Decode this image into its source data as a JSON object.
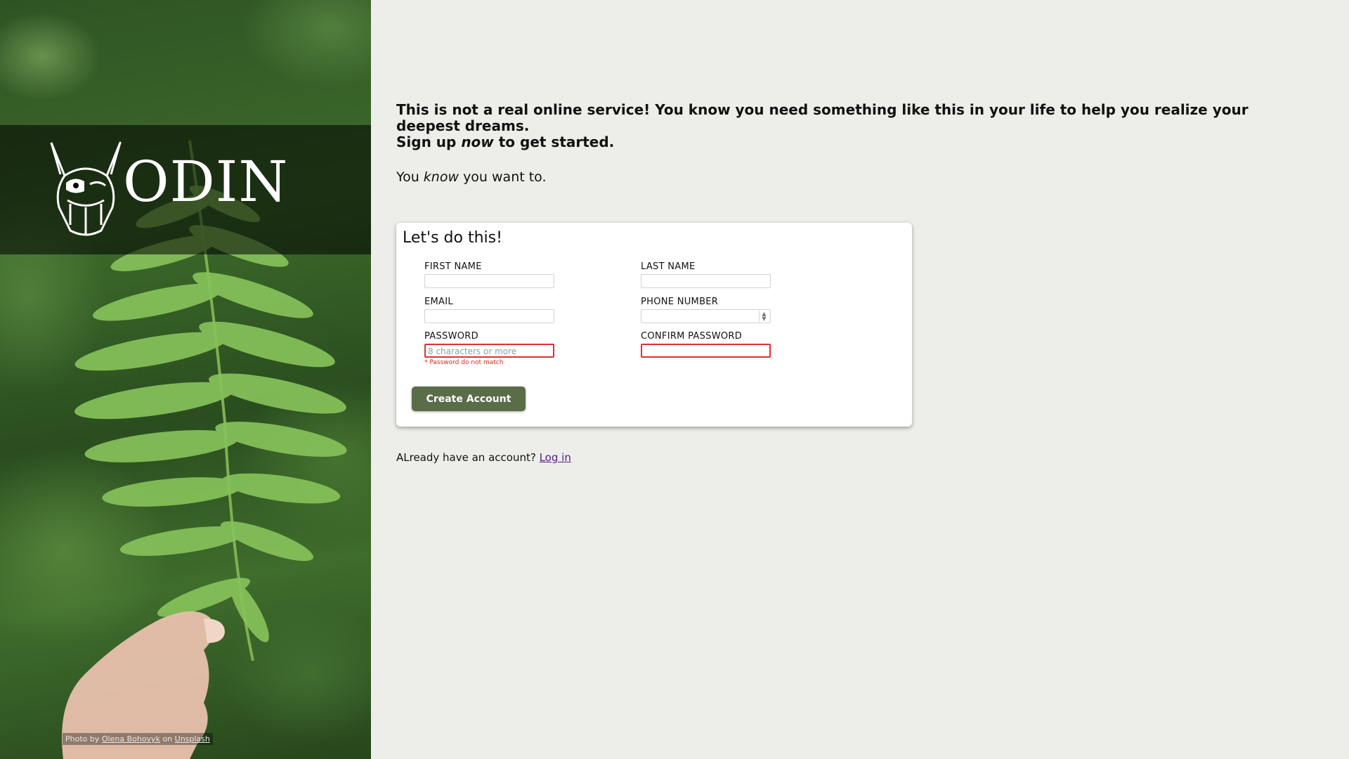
{
  "brand": {
    "name": "ODIN"
  },
  "credit": {
    "prefix": "Photo by",
    "author": "Olena Bohovyk",
    "mid": "on",
    "source": "Unsplash"
  },
  "intro": {
    "line1": "This is not a real online service! You know you need something like this in your life to help you realize your deepest dreams.",
    "line2_pre": "Sign up",
    "line2_em": "now",
    "line2_post": "to get started.",
    "sub_pre": "You",
    "sub_em": "know",
    "sub_post": "you want to."
  },
  "form": {
    "title": "Let's do this!",
    "first_name_label": "FIRST NAME",
    "last_name_label": "LAST NAME",
    "email_label": "EMAIL",
    "phone_label": "PHONE NUMBER",
    "password_label": "PASSWORD",
    "password_placeholder": "8 characters or more",
    "password_error": "* Password do not match",
    "confirm_label": "CONFIRM PASSWORD",
    "submit_label": "Create Account"
  },
  "footer": {
    "text": "ALready have an account?",
    "link": "Log in"
  },
  "colors": {
    "accent": "#5b6c48",
    "error": "#e03030",
    "link": "#551a8b"
  },
  "icons": {
    "logo": "viking-helmet-icon",
    "spinner": "stepper-arrows-icon"
  }
}
